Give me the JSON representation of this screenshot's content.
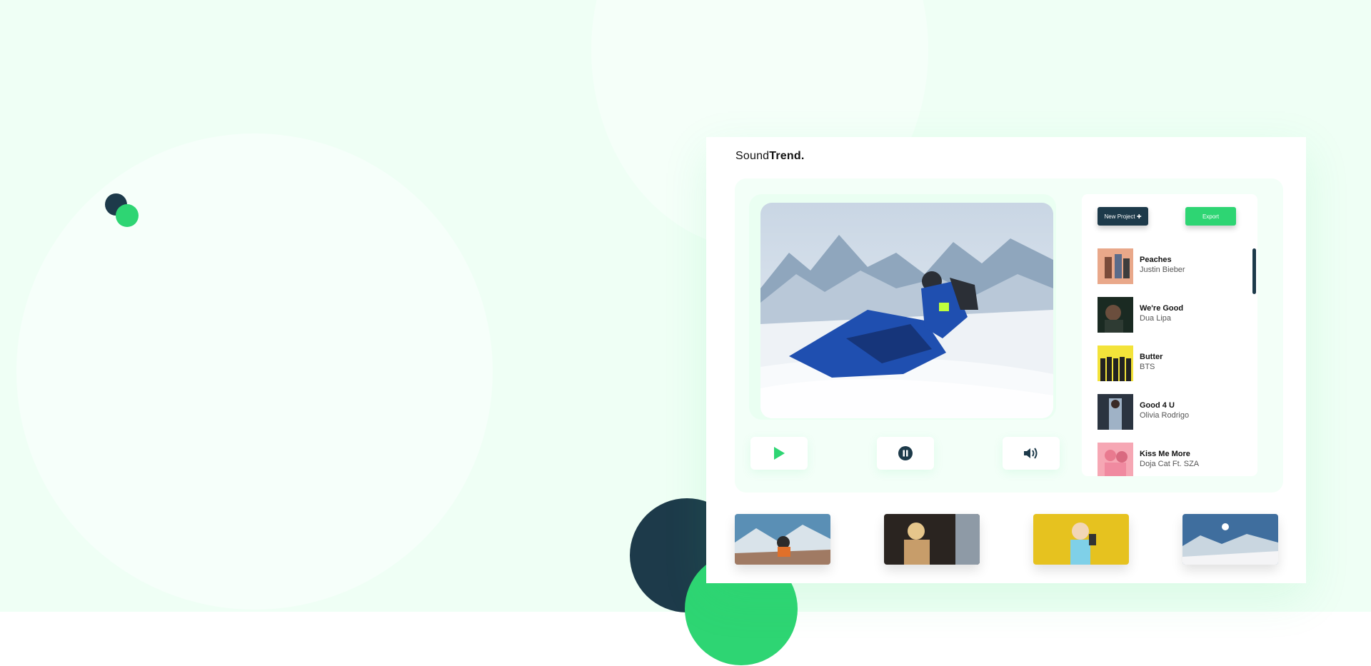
{
  "brand": {
    "prefix": "Sound",
    "bold": "Trend."
  },
  "actions": {
    "new_project": "New Project ✚",
    "export": "Export"
  },
  "player": {
    "play_icon": "play-icon",
    "pause_icon": "pause-icon",
    "volume_icon": "volume-icon"
  },
  "playlist": [
    {
      "title": "Peaches",
      "artist": "Justin Bieber"
    },
    {
      "title": "We're Good",
      "artist": "Dua Lipa"
    },
    {
      "title": "Butter",
      "artist": "BTS"
    },
    {
      "title": "Good 4 U",
      "artist": "Olivia Rodrigo"
    },
    {
      "title": "Kiss Me More",
      "artist": "Doja Cat Ft. SZA"
    }
  ],
  "colors": {
    "accent": "#2ed573",
    "dark": "#1d3a4a",
    "background": "#effff5"
  }
}
